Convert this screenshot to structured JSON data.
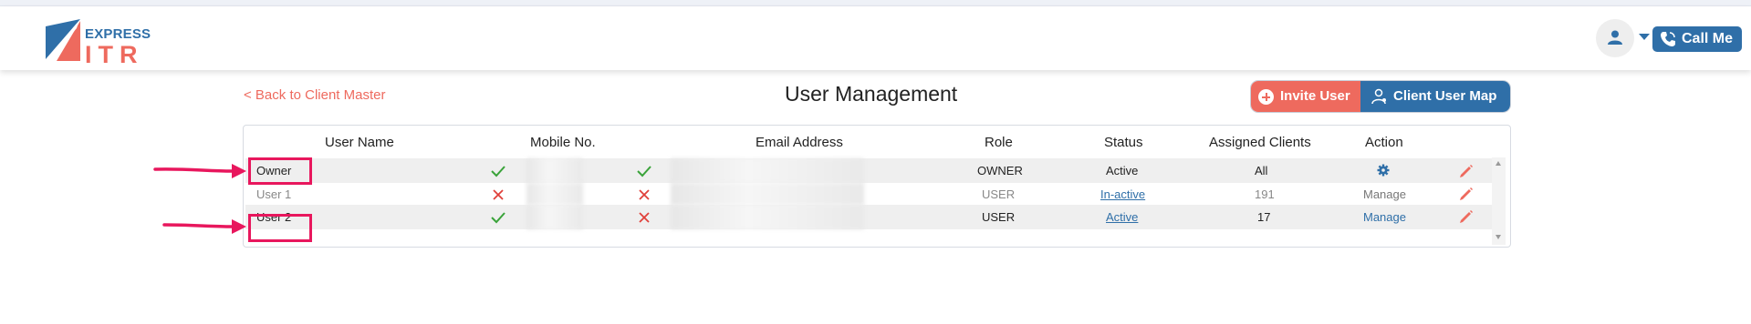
{
  "header": {
    "logo": {
      "word_top": "EXPRESS",
      "word_bottom": "ITR"
    },
    "call_button": "Call Me",
    "icons": {
      "avatar": "user-icon",
      "caret": "chevron-down-icon",
      "call": "phone-icon"
    }
  },
  "page": {
    "back_link": "< Back to Client Master",
    "title": "User Management",
    "buttons": {
      "invite": "Invite User",
      "map": "Client User Map"
    }
  },
  "table": {
    "columns": {
      "user_name": "User Name",
      "mobile": "Mobile No.",
      "email": "Email Address",
      "role": "Role",
      "status": "Status",
      "assigned": "Assigned Clients",
      "action": "Action"
    },
    "rows": [
      {
        "user": "Owner",
        "mobile_verified": true,
        "email_verified": true,
        "role": "OWNER",
        "status": "Active",
        "assigned": "All",
        "action": "gear-icon"
      },
      {
        "user": "User 1",
        "mobile_verified": false,
        "email_verified": false,
        "role": "USER",
        "status": "In-active",
        "assigned": "191",
        "action": "Manage"
      },
      {
        "user": "User 2",
        "mobile_verified": true,
        "email_verified": false,
        "role": "USER",
        "status": "Active",
        "assigned": "17",
        "action": "Manage"
      }
    ]
  },
  "colors": {
    "brand_blue": "#2f6fa8",
    "brand_coral": "#ee6a5e",
    "check_green": "#3aa33a",
    "cross_red": "#e0403a",
    "highlight_pink": "#e8175d"
  }
}
